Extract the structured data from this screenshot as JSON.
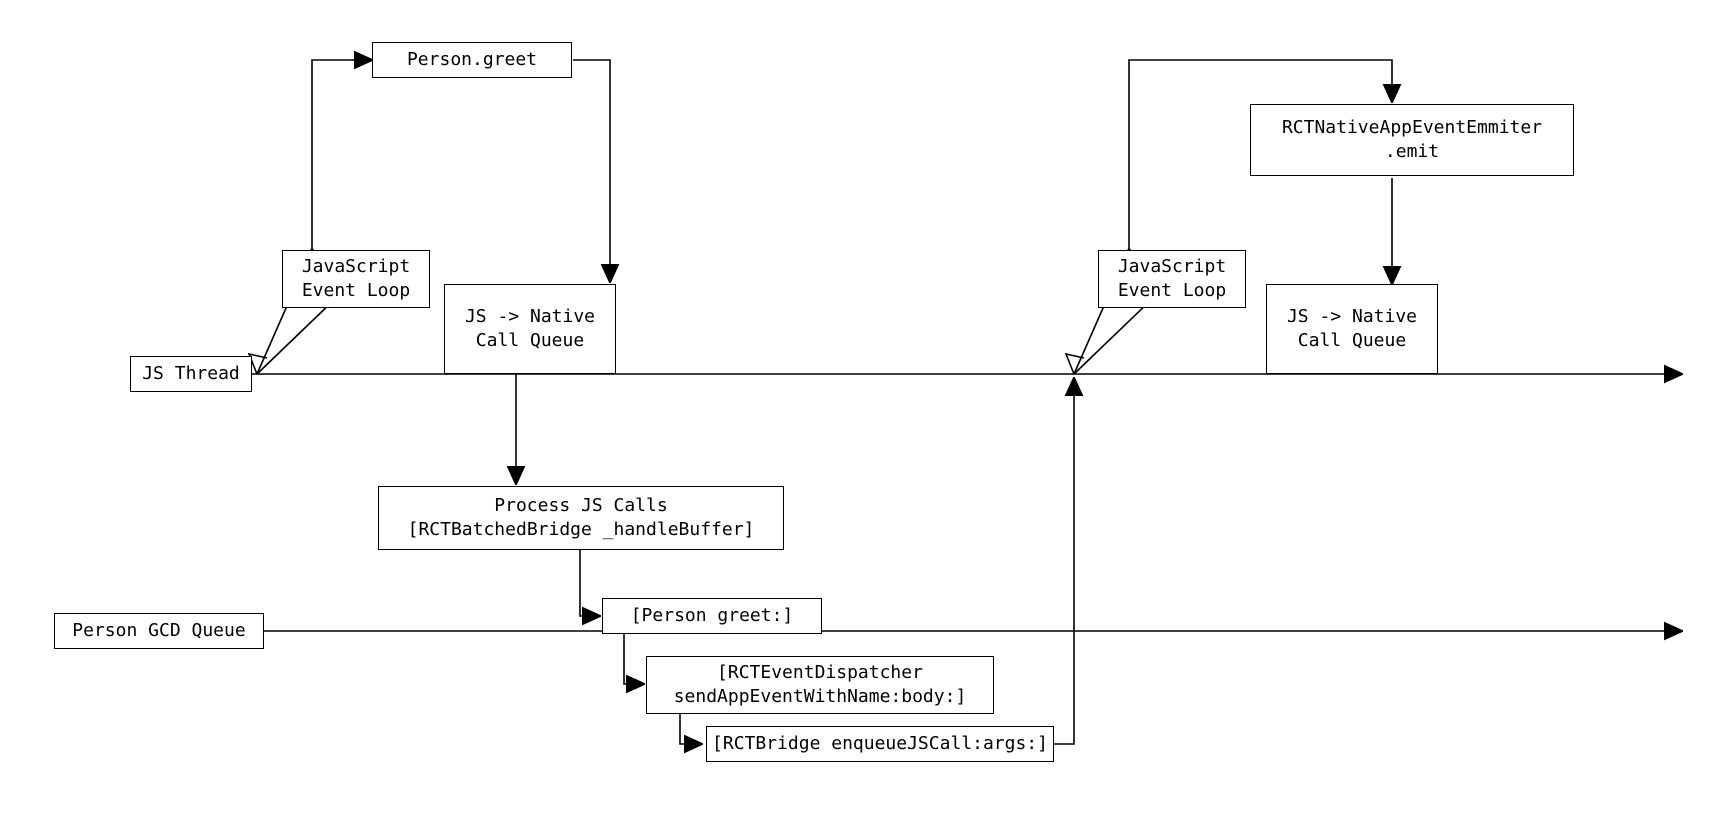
{
  "labels": {
    "jsThread": "JS Thread",
    "personGcdQueue": "Person GCD Queue",
    "personGreet": "Person.greet",
    "jsEventLoop1": "JavaScript\nEvent Loop",
    "jsEventLoop2": "JavaScript\nEvent Loop",
    "jsNativeQueue1": "JS -> Native\nCall Queue",
    "jsNativeQueue2": "JS -> Native\nCall Queue",
    "processJsCalls": "Process JS Calls\n[RCTBatchedBridge _handleBuffer]",
    "personGreetNative": "[Person greet:]",
    "eventDispatcher": "[RCTEventDispatcher\nsendAppEventWithName:body:]",
    "enqueueJsCall": "[RCTBridge enqueueJSCall:args:]",
    "nativeEmit": "RCTNativeAppEventEmmiter\n.emit"
  }
}
